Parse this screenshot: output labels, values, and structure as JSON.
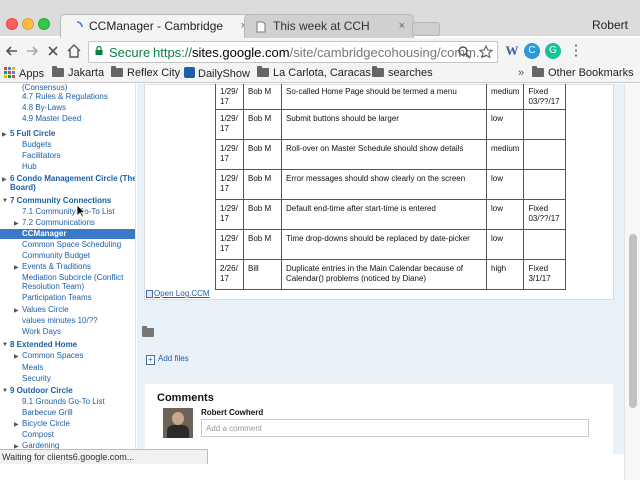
{
  "browser": {
    "user_name": "Robert",
    "tabs": [
      {
        "title": "CCManager - Cambridge Coho",
        "active": true
      },
      {
        "title": "This week at CCH",
        "active": false
      }
    ],
    "close_glyph": "×",
    "omnibox": {
      "secure_label": "Secure",
      "url_scheme": "https://",
      "url_host": "sites.google.com",
      "url_path": "/site/cambridgecohousing/comm..."
    },
    "toolbar_icons": [
      "back-icon",
      "forward-icon",
      "reload-icon",
      "home-icon",
      "search-icon",
      "star-icon",
      "wikipedia-extension-icon",
      "sync-extension-icon",
      "grammarly-extension-icon",
      "menu-icon"
    ],
    "extension_glyphs": {
      "wikipedia": "W",
      "sync": "C",
      "grammarly": "G",
      "menu": "⋮"
    },
    "bookmarks": [
      "Apps",
      "Jakarta",
      "Reflex City",
      "DailyShow",
      "La Carlota, Caracas",
      "searches"
    ],
    "bookmarks_overflow": "»",
    "other_bookmarks": "Other Bookmarks",
    "status_text": "Waiting for clients6.google.com..."
  },
  "sidebar": {
    "items": [
      {
        "label": "(Consensus)",
        "level": 2
      },
      {
        "label": "4.7 Rules & Regulations",
        "level": 2
      },
      {
        "label": "4.8 By-Laws",
        "level": 2
      },
      {
        "label": "4.9 Master Deed",
        "level": 2
      },
      {
        "label": "5 Full Circle",
        "level": 0,
        "arrow": "right"
      },
      {
        "label": "Budgets",
        "level": 2
      },
      {
        "label": "Facilitators",
        "level": 2
      },
      {
        "label": "Hub",
        "level": 2
      },
      {
        "label": "6 Condo Management Circle (The",
        "level": 0,
        "arrow": "right"
      },
      {
        "label": "Board)",
        "level": 0
      },
      {
        "label": "7 Community Connections",
        "level": 0,
        "arrow": "down"
      },
      {
        "label": "7.1 Community Go-To List",
        "level": 2
      },
      {
        "label": "7.2 Communications",
        "level": 2,
        "arrow": "right"
      },
      {
        "label": "CCManager",
        "level": 2,
        "selected": true
      },
      {
        "label": "Common Space Scheduling",
        "level": 2
      },
      {
        "label": "Community Budget",
        "level": 2
      },
      {
        "label": "Events & Traditions",
        "level": 2,
        "arrow": "right"
      },
      {
        "label": "Mediation Subcircle (Conflict",
        "level": 2
      },
      {
        "label": "Resolution Team)",
        "level": 2
      },
      {
        "label": "Participation Teams",
        "level": 2
      },
      {
        "label": "Values Circle",
        "level": 2,
        "arrow": "right"
      },
      {
        "label": "values minutes 10/??",
        "level": 2
      },
      {
        "label": "Work Days",
        "level": 2
      },
      {
        "label": "8 Extended Home",
        "level": 0,
        "arrow": "down"
      },
      {
        "label": "Common Spaces",
        "level": 2,
        "arrow": "right"
      },
      {
        "label": "Meals",
        "level": 2
      },
      {
        "label": "Security",
        "level": 2
      },
      {
        "label": "9 Outdoor Circle",
        "level": 0,
        "arrow": "down"
      },
      {
        "label": "9.1 Grounds Go-To List",
        "level": 2
      },
      {
        "label": "Barbecue Grill",
        "level": 2
      },
      {
        "label": "Bicycle Circle",
        "level": 2,
        "arrow": "right"
      },
      {
        "label": "Compost",
        "level": 2
      },
      {
        "label": "Gardening",
        "level": 2,
        "arrow": "right"
      }
    ]
  },
  "log": {
    "rows": [
      {
        "date": "1/29/\n17",
        "by": "Bob M",
        "desc": "So-called Home Page should be termed a menu",
        "priority": "medium",
        "status": "Fixed\n03/??/17"
      },
      {
        "date": "1/29/\n17",
        "by": "Bob M",
        "desc": "Submit buttons should be larger",
        "priority": "low",
        "status": ""
      },
      {
        "date": "1/29/\n17",
        "by": "Bob M",
        "desc": "Roll-over on Master Schedule should show details",
        "priority": "medium",
        "status": ""
      },
      {
        "date": "1/29/\n17",
        "by": "Bob M",
        "desc": "Error messages should show clearly on the screen",
        "priority": "low",
        "status": ""
      },
      {
        "date": "1/29/\n17",
        "by": "Bob M",
        "desc": "Default end-time after start-time is entered",
        "priority": "low",
        "status": "Fixed\n03/??/17"
      },
      {
        "date": "1/29/\n17",
        "by": "Bob M",
        "desc": "Time drop-downs should be replaced by date-picker",
        "priority": "low",
        "status": ""
      },
      {
        "date": "2/26/\n17",
        "by": "Bill",
        "desc": "Duplicate entries in the Main Calendar because of Calendar() problems (noticed by Diane)",
        "priority": "high",
        "status": "Fixed\n3/1/17"
      }
    ],
    "open_link": "Open Log.CCM"
  },
  "attachments": {
    "add_files": "Add files"
  },
  "comments": {
    "title": "Comments",
    "author": "Robert Cowherd",
    "placeholder": "Add a comment"
  }
}
